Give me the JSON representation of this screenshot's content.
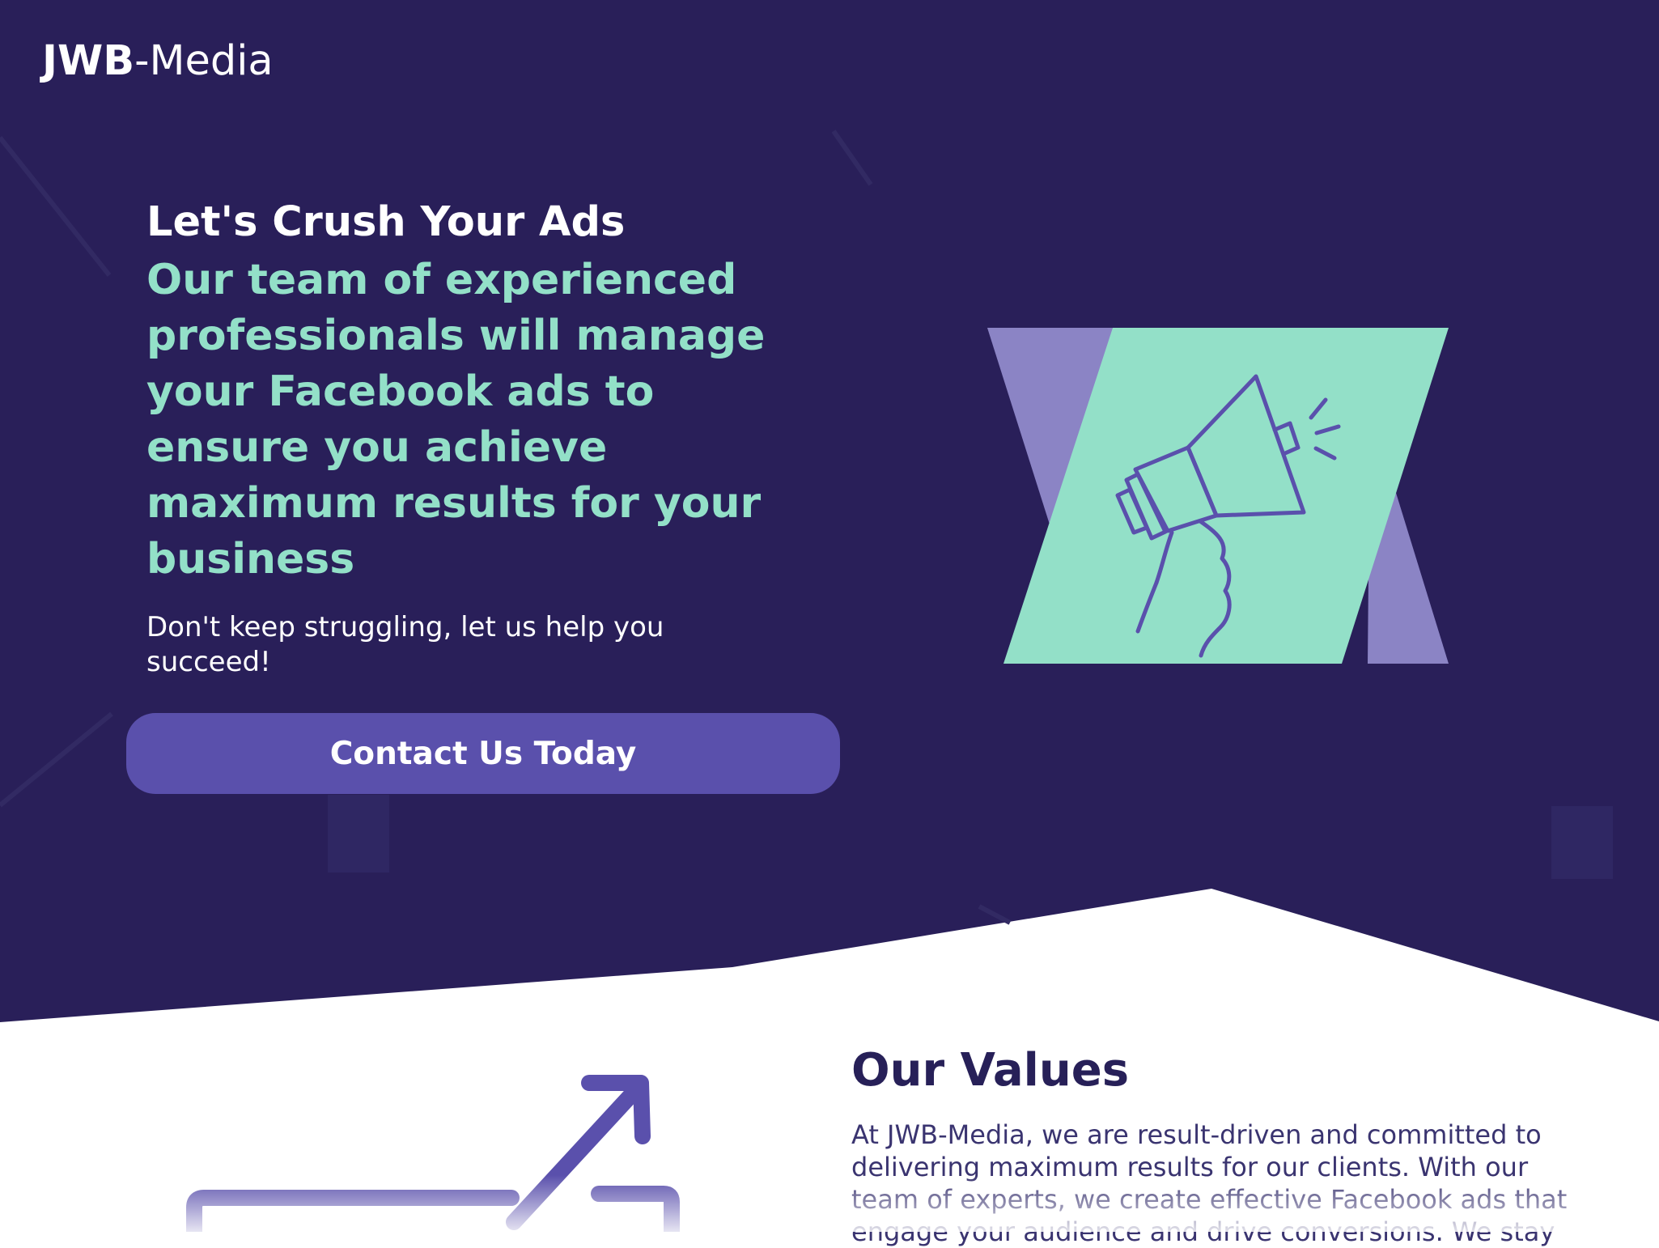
{
  "header": {
    "logo_bold": "JWB",
    "logo_light": "-Media"
  },
  "hero": {
    "title": "Let's Crush Your Ads",
    "subtitle": "Our team of experienced professionals will manage your Facebook ads to ensure you achieve maximum results for your business",
    "body": "Don't keep struggling, let us help you succeed!",
    "cta_label": "Contact Us Today",
    "illustration_icon": "megaphone-icon"
  },
  "values": {
    "title": "Our Values",
    "body": "At JWB-Media, we are result-driven and committed to delivering maximum results for our clients. With our team of experts, we create effective Facebook ads that engage your audience and drive conversions. We stay",
    "illustration_icon": "growth-arrow-icon"
  },
  "colors": {
    "hero_background": "#291f59",
    "accent_mint": "#93e0c8",
    "accent_purple": "#5a50ac",
    "illustration_lavender": "#8b84c5",
    "heading_dark": "#272058"
  }
}
